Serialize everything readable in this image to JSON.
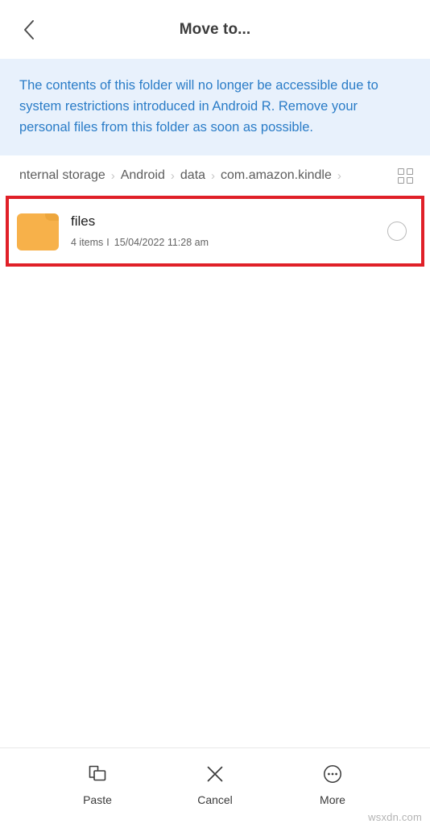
{
  "header": {
    "title": "Move to...",
    "back_icon": "chevron-left-icon"
  },
  "banner": {
    "message": "The contents of this folder will no longer be accessible due to system restrictions introduced in Android R. Remove your personal files from this folder as soon as possible.",
    "background_color": "#e8f1fc",
    "text_color": "#2a7cc7"
  },
  "breadcrumb": {
    "separator": "›",
    "crumbs": [
      {
        "label": "nternal storage"
      },
      {
        "label": "Android"
      },
      {
        "label": "data"
      },
      {
        "label": "com.amazon.kindle"
      }
    ],
    "trailing_separator": "›",
    "view_toggle_icon": "grid-view-icon"
  },
  "file_list": {
    "items": [
      {
        "name": "files",
        "item_count": "4 items",
        "separator": "I",
        "modified": "15/04/2022 11:28 am",
        "icon": "folder-icon",
        "icon_color": "#f7b14a",
        "selected": false
      }
    ]
  },
  "annotation": {
    "highlight_color": "#e02028"
  },
  "bottom_bar": {
    "actions": [
      {
        "label": "Paste",
        "icon": "paste-icon"
      },
      {
        "label": "Cancel",
        "icon": "close-x-icon"
      },
      {
        "label": "More",
        "icon": "more-circle-icon"
      }
    ]
  },
  "watermark": {
    "text": "wsxdn.com"
  }
}
